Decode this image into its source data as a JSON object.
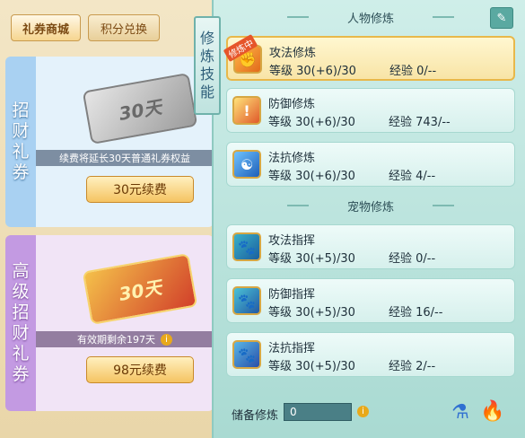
{
  "tabs": {
    "gift_shop": "礼券商城",
    "points_exchange": "积分兑换"
  },
  "cards": [
    {
      "title": [
        "招",
        "财",
        "礼",
        "券"
      ],
      "ticket": "30天",
      "info": "续费将延长30天普通礼券权益",
      "button": "30元续费"
    },
    {
      "title": [
        "高",
        "级",
        "招",
        "财",
        "礼",
        "券"
      ],
      "ticket": "30天",
      "info": "有效期剩余197天",
      "button": "98元续费"
    }
  ],
  "side_label": [
    "修",
    "炼",
    "技",
    "能"
  ],
  "character": {
    "title": "人物修炼",
    "badge": "修炼中",
    "rows": [
      {
        "name": "攻法修炼",
        "level": "等级  30(+6)/30",
        "exp": "经验  0/--"
      },
      {
        "name": "防御修炼",
        "level": "等级  30(+6)/30",
        "exp": "经验  743/--"
      },
      {
        "name": "法抗修炼",
        "level": "等级  30(+6)/30",
        "exp": "经验  4/--"
      }
    ]
  },
  "pet": {
    "title": "宠物修炼",
    "rows": [
      {
        "name": "攻法指挥",
        "level": "等级  30(+5)/30",
        "exp": "经验  0/--"
      },
      {
        "name": "防御指挥",
        "level": "等级  30(+5)/30",
        "exp": "经验  16/--"
      },
      {
        "name": "法抗指挥",
        "level": "等级  30(+5)/30",
        "exp": "经验  2/--"
      }
    ]
  },
  "reserve": {
    "label": "储备修炼",
    "value": "0"
  },
  "icons": {
    "info": "i",
    "edit": "✎",
    "potion": "⚗",
    "flame": "🔥"
  }
}
